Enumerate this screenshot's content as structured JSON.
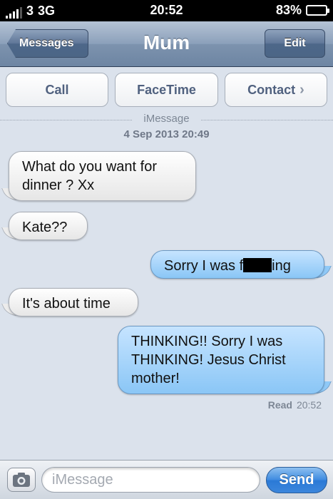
{
  "status_bar": {
    "carrier": "3",
    "network": "3G",
    "time": "20:52",
    "battery": "83%",
    "battery_level": 0.83
  },
  "nav": {
    "back_label": "Messages",
    "title": "Mum",
    "edit_label": "Edit"
  },
  "actions": {
    "call": "Call",
    "facetime": "FaceTime",
    "contact": "Contact"
  },
  "thread_header": {
    "service": "iMessage",
    "date": "4 Sep 2013 20:49"
  },
  "messages": [
    {
      "direction": "incoming",
      "text": "What do you want for dinner ? Xx"
    },
    {
      "direction": "incoming",
      "text": "Kate??"
    },
    {
      "direction": "outgoing",
      "text_before": "Sorry I was f",
      "text_after": "ing"
    },
    {
      "direction": "incoming",
      "text": "It's about time"
    },
    {
      "direction": "outgoing",
      "text": "THINKING!! Sorry I was THINKING! Jesus Christ mother!"
    }
  ],
  "read_receipt": {
    "label": "Read",
    "time": "20:52"
  },
  "composer": {
    "placeholder": "iMessage",
    "send_label": "Send"
  },
  "colors": {
    "outgoing_bubble": "#8ac6f6",
    "incoming_bubble": "#ffffff",
    "background": "#dbe2ec",
    "send_button": "#2a79d6"
  }
}
